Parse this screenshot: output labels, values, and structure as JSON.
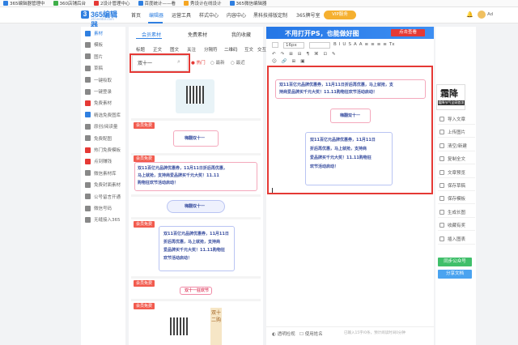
{
  "bookmarks": [
    {
      "label": "365编辑器管理中",
      "color": "#2f7fe0"
    },
    {
      "label": "360店铺后台",
      "color": "#3fae49"
    },
    {
      "label": "2设计管理中心",
      "color": "#e53935"
    },
    {
      "label": "百度统计——看",
      "color": "#2f7fe0"
    },
    {
      "label": "秀设计在线设计",
      "color": "#f5a623"
    },
    {
      "label": "365微信编辑器",
      "color": "#2f7fe0"
    }
  ],
  "logo": {
    "mark": "3",
    "name": "365编辑器",
    "sub": "365editor.com"
  },
  "topnav": {
    "items": [
      "首页",
      "编辑器",
      "运营工具",
      "样式中心",
      "内容中心",
      "黑科技排版定制",
      "365牌号室"
    ],
    "vip": "VIP服务",
    "user": "Ad"
  },
  "sidebar": {
    "items": [
      {
        "label": "素材",
        "icon": "folder-icon",
        "color": "#2f7fe0"
      },
      {
        "label": "模板",
        "icon": "template-icon",
        "color": "#888"
      },
      {
        "label": "图片",
        "icon": "image-icon",
        "color": "#888"
      },
      {
        "label": "草稿",
        "icon": "draft-icon",
        "color": "#888"
      },
      {
        "label": "一键吸取",
        "icon": "grab-icon",
        "color": "#888"
      },
      {
        "label": "一键登录",
        "icon": "login-icon",
        "color": "#888"
      },
      {
        "label": "免费素材",
        "icon": "free-icon",
        "color": "#e53935"
      },
      {
        "label": "精选免费图库",
        "icon": "gallery-icon",
        "color": "#2f7fe0"
      },
      {
        "label": "原创/阅读量",
        "icon": "read-icon",
        "color": "#888"
      },
      {
        "label": "免费配图",
        "icon": "picture-icon",
        "color": "#888"
      },
      {
        "label": "热门免费模板",
        "icon": "hot-icon",
        "color": "#e53935"
      },
      {
        "label": "点到赚钱",
        "icon": "money-icon",
        "color": "#e53935"
      },
      {
        "label": "微信素材库",
        "icon": "wechat-icon",
        "color": "#888"
      },
      {
        "label": "免费封面素材",
        "icon": "cover-icon",
        "color": "#888"
      },
      {
        "label": "公号留言开通",
        "icon": "comment-icon",
        "color": "#888"
      },
      {
        "label": "微信号码",
        "icon": "phone-icon",
        "color": "#888"
      },
      {
        "label": "无缝接入365",
        "icon": "link-icon",
        "color": "#888"
      }
    ]
  },
  "panel": {
    "tabs": [
      "会员素材",
      "免费素材",
      "我的收藏"
    ],
    "categories": [
      "标题",
      "正文",
      "图文",
      "关注",
      "分隔符",
      "二维码",
      "互文",
      "交互"
    ],
    "search": {
      "value": "双十一"
    },
    "filters": [
      "热门",
      "最新",
      "最近"
    ],
    "badge": "会员免费",
    "cards": {
      "title_banner": "嗨翻双十一",
      "body_text": [
        "双11百亿元品牌优惠券，11月11日折后再优惠，",
        "马上就抢，支持商爱品牌买千元大奖！11.11",
        "购物狂欢节活动启动！"
      ],
      "title_banner2": "嗨翻双十一",
      "body_text2": [
        "双11百亿元品牌优惠券，11月11日",
        "折后再优惠，马上就抢，支持商",
        "爱品牌买千元大奖！11.11购物狂",
        "欢节活动启动！"
      ],
      "title_banner3": "双十一狂欢节",
      "vertical": "双十二购"
    }
  },
  "editor": {
    "banner": "不用打开PS，也能做好图",
    "banner_btn": "点击查看",
    "font_size": "16px",
    "toolbar_row1": [
      "B",
      "I",
      "U",
      "S",
      "A",
      "A",
      "≡",
      "≡",
      "≡",
      "≡",
      "Tx"
    ],
    "toolbar_row2": [
      "↶",
      "↷",
      "⊞",
      "⊟",
      "¶",
      "⌘",
      "⊡",
      "✎"
    ],
    "content_text": [
      "双11百亿元品牌优惠券，11月11日折后再优惠，马上就抢，支",
      "持商爱品牌买千元大奖！11.11购物狂欢节活动启动！"
    ],
    "content_title": "嗨翻双十一",
    "content_text2": [
      "双11百亿元品牌优惠券，11月11日",
      "折后再优惠，马上就抢，支持商",
      "爱品牌买千元大奖！11.11购物狂",
      "欢节活动启动！"
    ],
    "bottom": [
      "透明检视",
      "使用姓名"
    ],
    "bottom_right": "已输入15字/0条，预计阅读时间0分钟"
  },
  "right": {
    "ad_text": "霜降",
    "ad_sub": "霜降节气全网首发",
    "buttons": [
      "导入文章",
      "上传图片",
      "清空/新建",
      "复制全文",
      "文章预览",
      "保存草稿",
      "保存模板",
      "生成长图",
      "收藏有奖",
      "插入图表"
    ],
    "sync": "同步公众号",
    "share": "分享文档"
  }
}
